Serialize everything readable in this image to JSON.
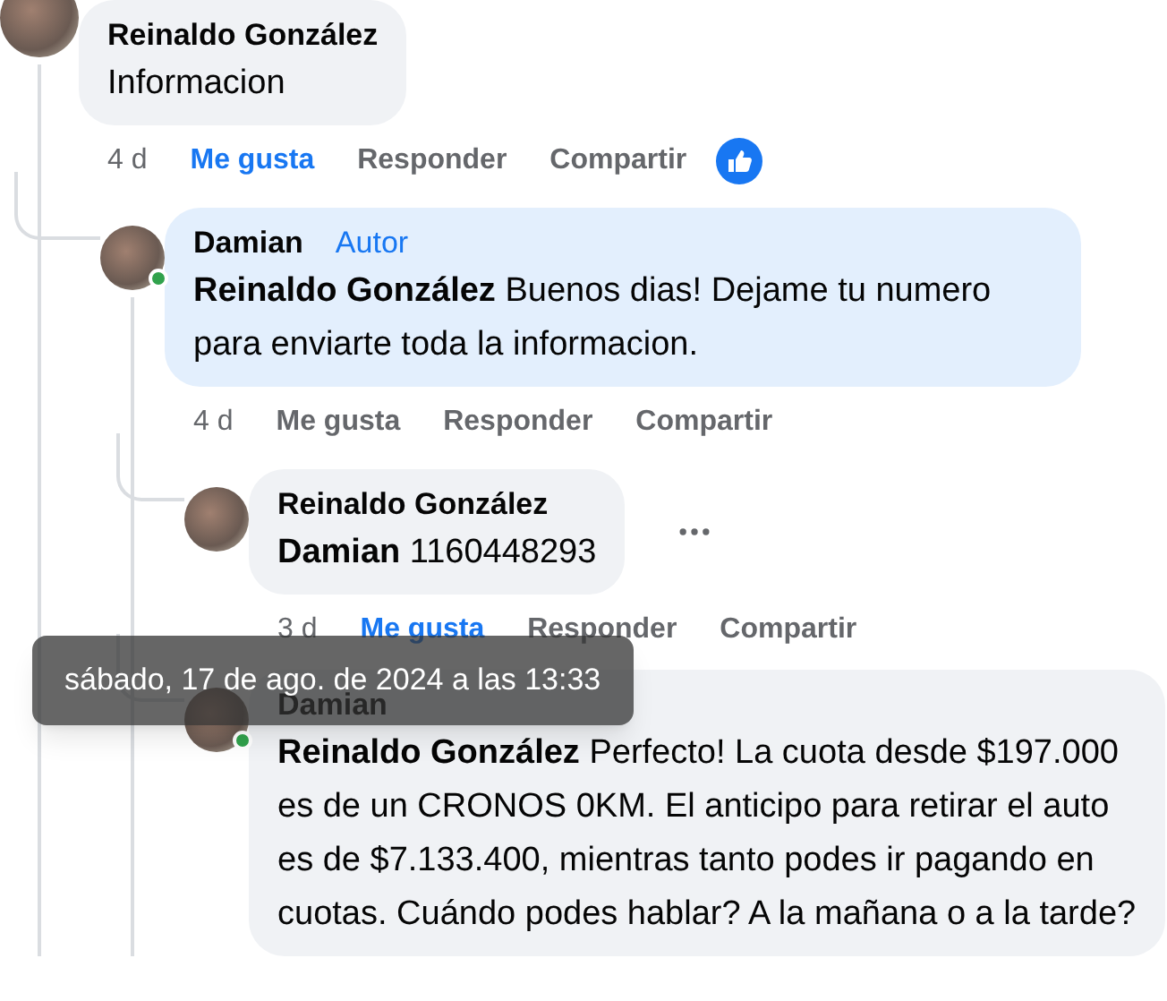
{
  "comments": [
    {
      "author": "Reinaldo González",
      "text": "Informacion",
      "reacted": true,
      "time": "4 d",
      "actions": [
        {
          "label": "Me gusta",
          "selected": true
        },
        {
          "label": "Responder",
          "selected": false
        },
        {
          "label": "Compartir",
          "selected": false
        }
      ],
      "children": [
        {
          "author": "Damian",
          "badge": "Autor",
          "text": "**Reinaldo González** Buenos dias! Dejame tu numero para enviarte toda la informacion.",
          "online": true,
          "highlighted": true,
          "time": "4 d",
          "actions": [
            {
              "label": "Me gusta",
              "selected": false
            },
            {
              "label": "Responder",
              "selected": false
            },
            {
              "label": "Compartir",
              "selected": false
            }
          ],
          "children": [
            {
              "author": "Reinaldo González",
              "text": "**Damian** 1160448293",
              "menu_visible": true,
              "time": "3 d",
              "actions": [
                {
                  "label": "Me gusta",
                  "selected": true
                },
                {
                  "label": "Responder",
                  "selected": false
                },
                {
                  "label": "Compartir",
                  "selected": false
                }
              ]
            },
            {
              "author": "Damian",
              "text": "**Reinaldo González** Perfecto! La cuota desde $197.000 es de un CRONOS 0KM. El anticipo para retirar el auto es de $7.133.400, mientras tanto podes ir pagando en cuotas. Cuándo podes hablar? A la mañana o a la tarde?",
              "online": true
            }
          ]
        }
      ]
    }
  ],
  "tooltip": {
    "text": "sábado, 17 de ago. de 2024 a las 13:33"
  }
}
